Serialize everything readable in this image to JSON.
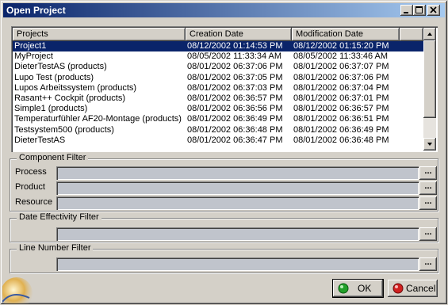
{
  "window": {
    "title": "Open Project",
    "title_bar_color": "#0a246a"
  },
  "title_buttons": {
    "minimize": "minimize-icon",
    "maximize": "maximize-icon",
    "close": "close-icon"
  },
  "project_list": {
    "columns": [
      "Projects",
      "Creation Date",
      "Modification Date"
    ],
    "selection_color": "#0a246a",
    "rows": [
      {
        "name": "Project1",
        "created": "08/12/2002 01:14:53 PM",
        "modified": "08/12/2002 01:15:20 PM",
        "selected": true
      },
      {
        "name": "MyProject",
        "created": "08/05/2002 11:33:34 AM",
        "modified": "08/05/2002 11:33:46 AM",
        "selected": false
      },
      {
        "name": "DieterTestAS (products)",
        "created": "08/01/2002 06:37:06 PM",
        "modified": "08/01/2002 06:37:07 PM",
        "selected": false
      },
      {
        "name": "Lupo Test (products)",
        "created": "08/01/2002 06:37:05 PM",
        "modified": "08/01/2002 06:37:06 PM",
        "selected": false
      },
      {
        "name": "Lupos Arbeitssystem (products)",
        "created": "08/01/2002 06:37:03 PM",
        "modified": "08/01/2002 06:37:04 PM",
        "selected": false
      },
      {
        "name": "Rasant++ Cockpit (products)",
        "created": "08/01/2002 06:36:57 PM",
        "modified": "08/01/2002 06:37:01 PM",
        "selected": false
      },
      {
        "name": "Simple1 (products)",
        "created": "08/01/2002 06:36:56 PM",
        "modified": "08/01/2002 06:36:57 PM",
        "selected": false
      },
      {
        "name": "Temperaturfühler AF20-Montage (products)",
        "created": "08/01/2002 06:36:49 PM",
        "modified": "08/01/2002 06:36:51 PM",
        "selected": false
      },
      {
        "name": "Testsystem500 (products)",
        "created": "08/01/2002 06:36:48 PM",
        "modified": "08/01/2002 06:36:49 PM",
        "selected": false
      },
      {
        "name": "DieterTestAS",
        "created": "08/01/2002 06:36:47 PM",
        "modified": "08/01/2002 06:36:48 PM",
        "selected": false
      }
    ]
  },
  "component_filter": {
    "legend": "Component Filter",
    "fields": [
      {
        "label": "Process",
        "value": "",
        "button": "..."
      },
      {
        "label": "Product",
        "value": "",
        "button": "..."
      },
      {
        "label": "Resource",
        "value": "",
        "button": "..."
      }
    ]
  },
  "date_filter": {
    "legend": "Date Effectivity Filter",
    "value": "",
    "button": "..."
  },
  "line_filter": {
    "legend": "Line Number Filter",
    "value": "",
    "button": "..."
  },
  "buttons": {
    "ok": {
      "label": "OK",
      "icon": "green-dot-icon",
      "color": "#22a02a"
    },
    "cancel": {
      "label": "Cancel",
      "icon": "red-dot-icon",
      "color": "#d02020"
    }
  }
}
